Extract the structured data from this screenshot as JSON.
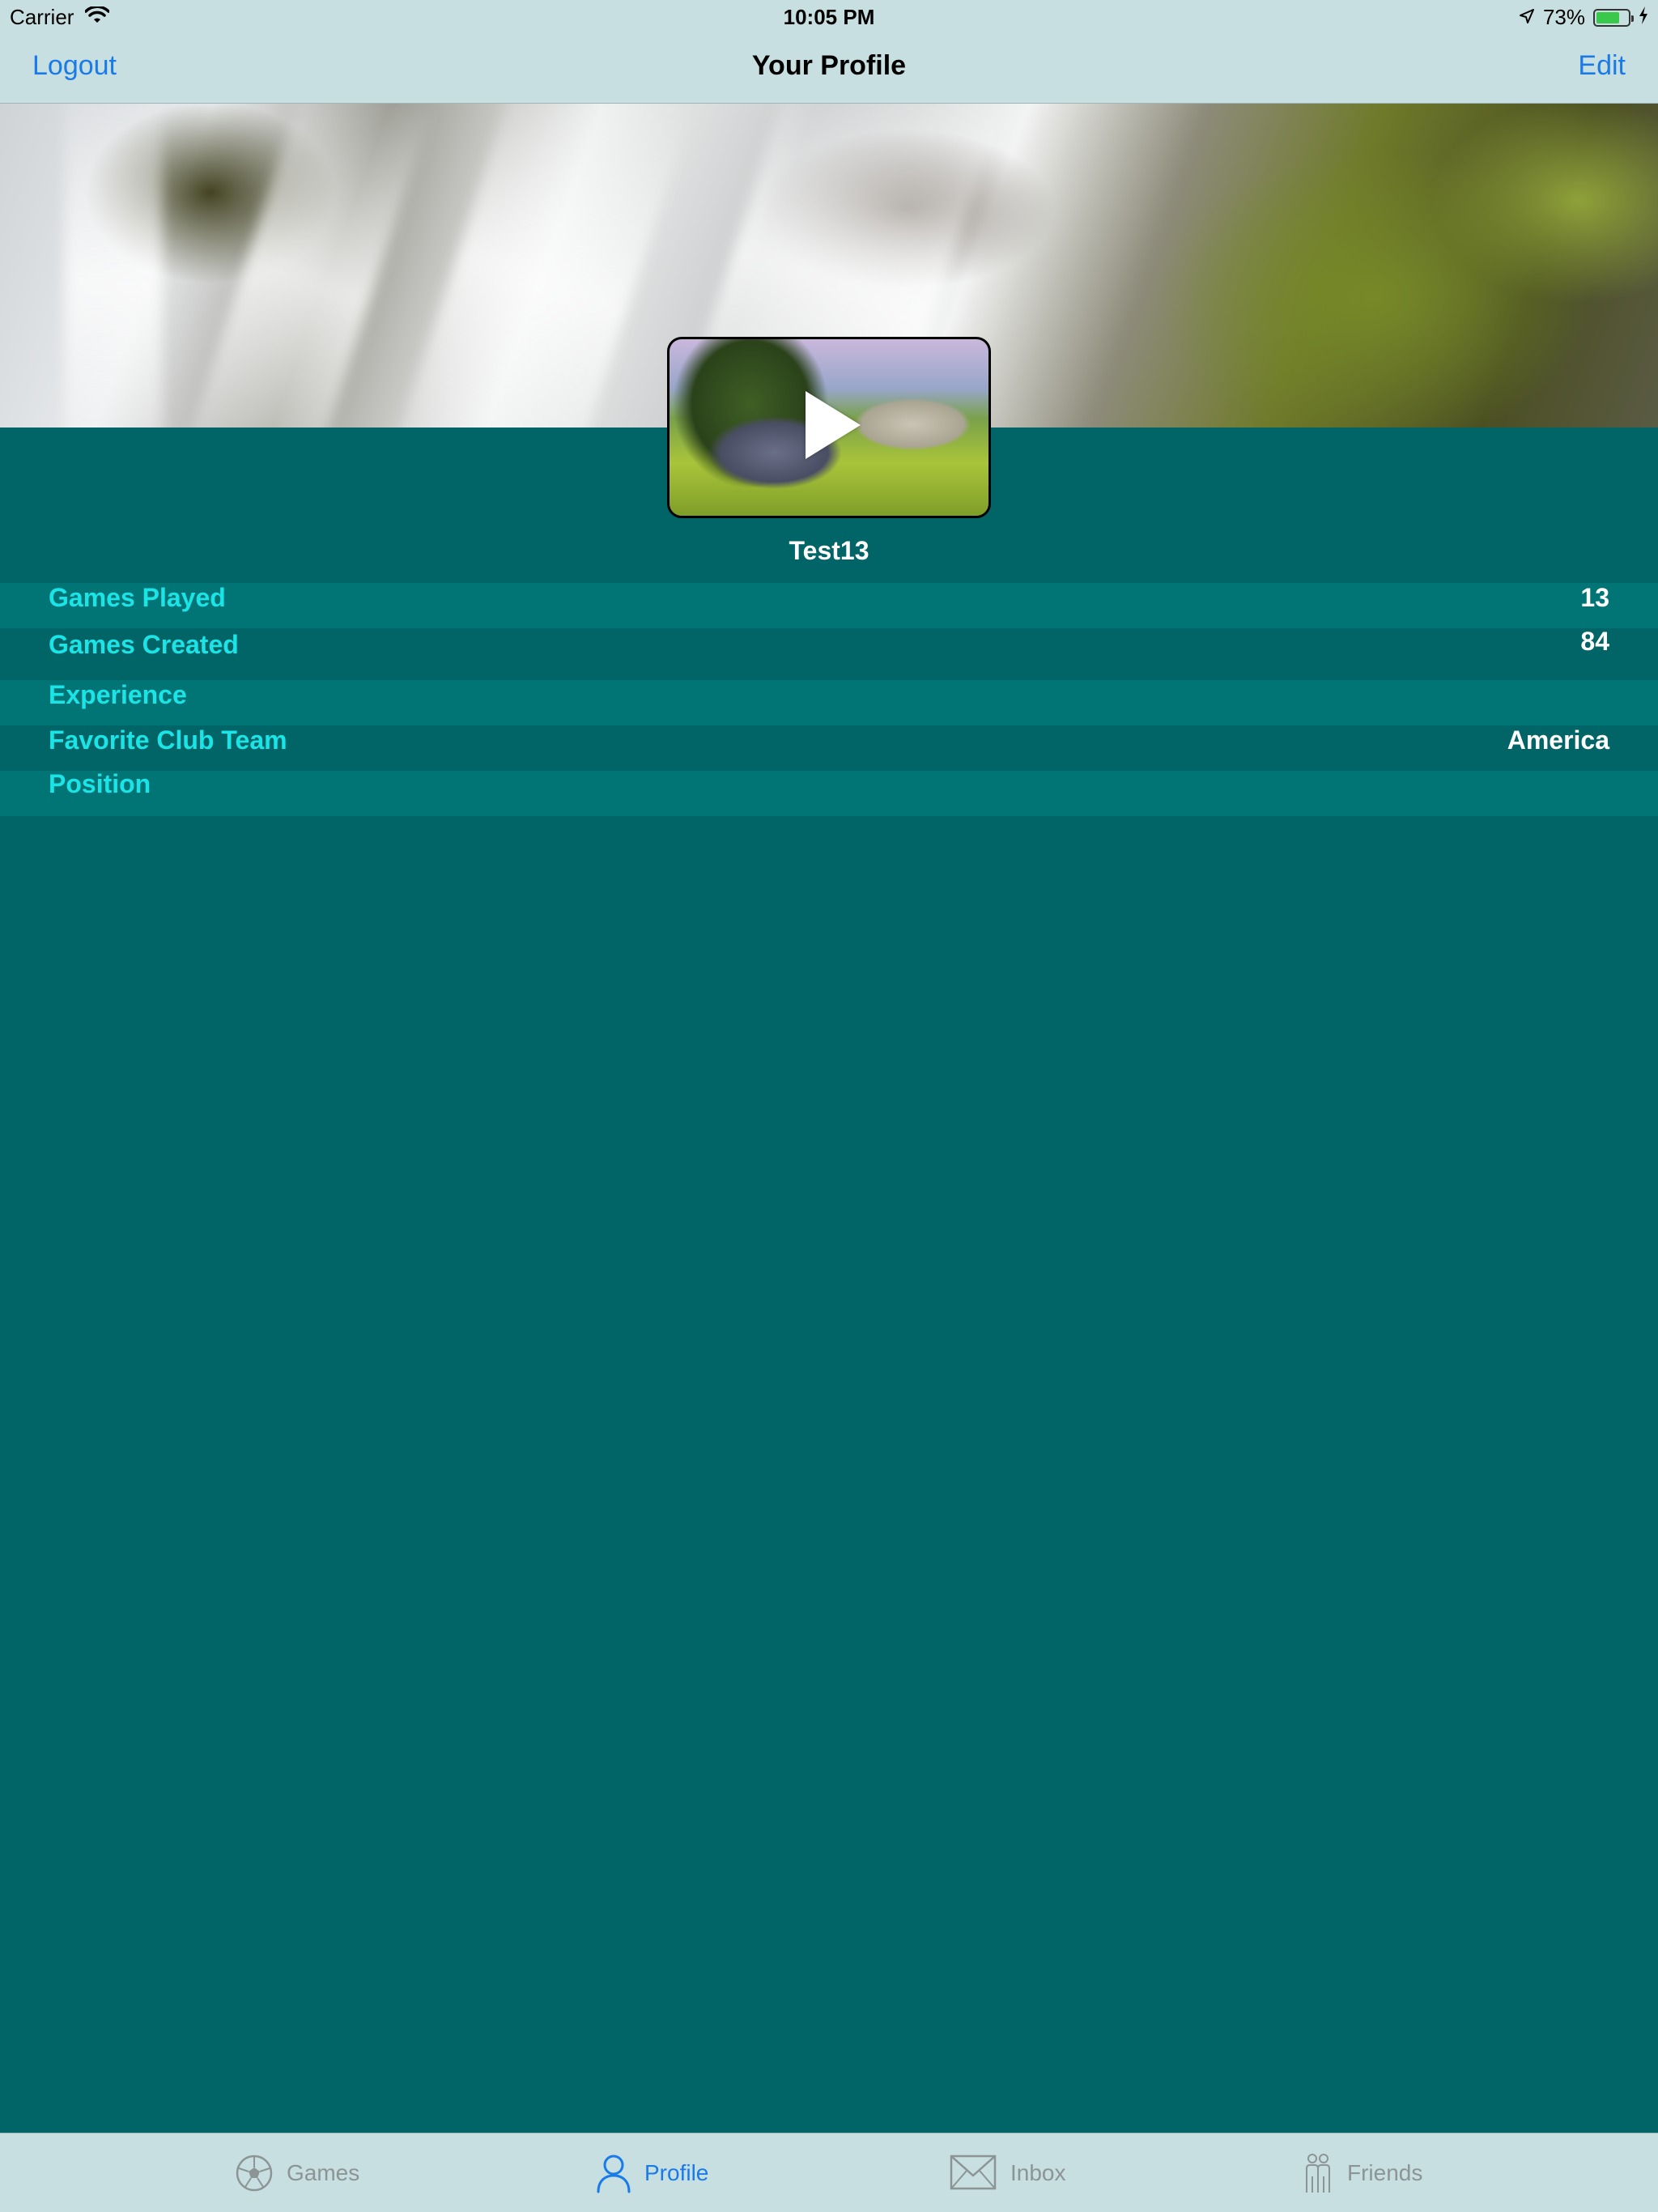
{
  "status_bar": {
    "carrier": "Carrier",
    "time": "10:05 PM",
    "battery_percent_label": "73%",
    "battery_level": 0.73
  },
  "nav": {
    "left_label": "Logout",
    "title": "Your Profile",
    "right_label": "Edit"
  },
  "profile": {
    "username": "Test13"
  },
  "stats": [
    {
      "label": "Games Played",
      "value": "13"
    },
    {
      "label": "Games Created",
      "value": "84"
    },
    {
      "label": "Experience",
      "value": ""
    },
    {
      "label": "Favorite Club Team",
      "value": "America"
    },
    {
      "label": "Position",
      "value": ""
    }
  ],
  "tabs": [
    {
      "label": "Games",
      "icon": "soccer-ball-icon",
      "active": false
    },
    {
      "label": "Profile",
      "icon": "person-icon",
      "active": true
    },
    {
      "label": "Inbox",
      "icon": "envelope-icon",
      "active": false
    },
    {
      "label": "Friends",
      "icon": "friends-icon",
      "active": false
    }
  ],
  "colors": {
    "background": "#016466",
    "row_alt": "#017576",
    "label": "#1be4e6",
    "accent": "#1a7be8",
    "bars": "#c7dfe0"
  }
}
